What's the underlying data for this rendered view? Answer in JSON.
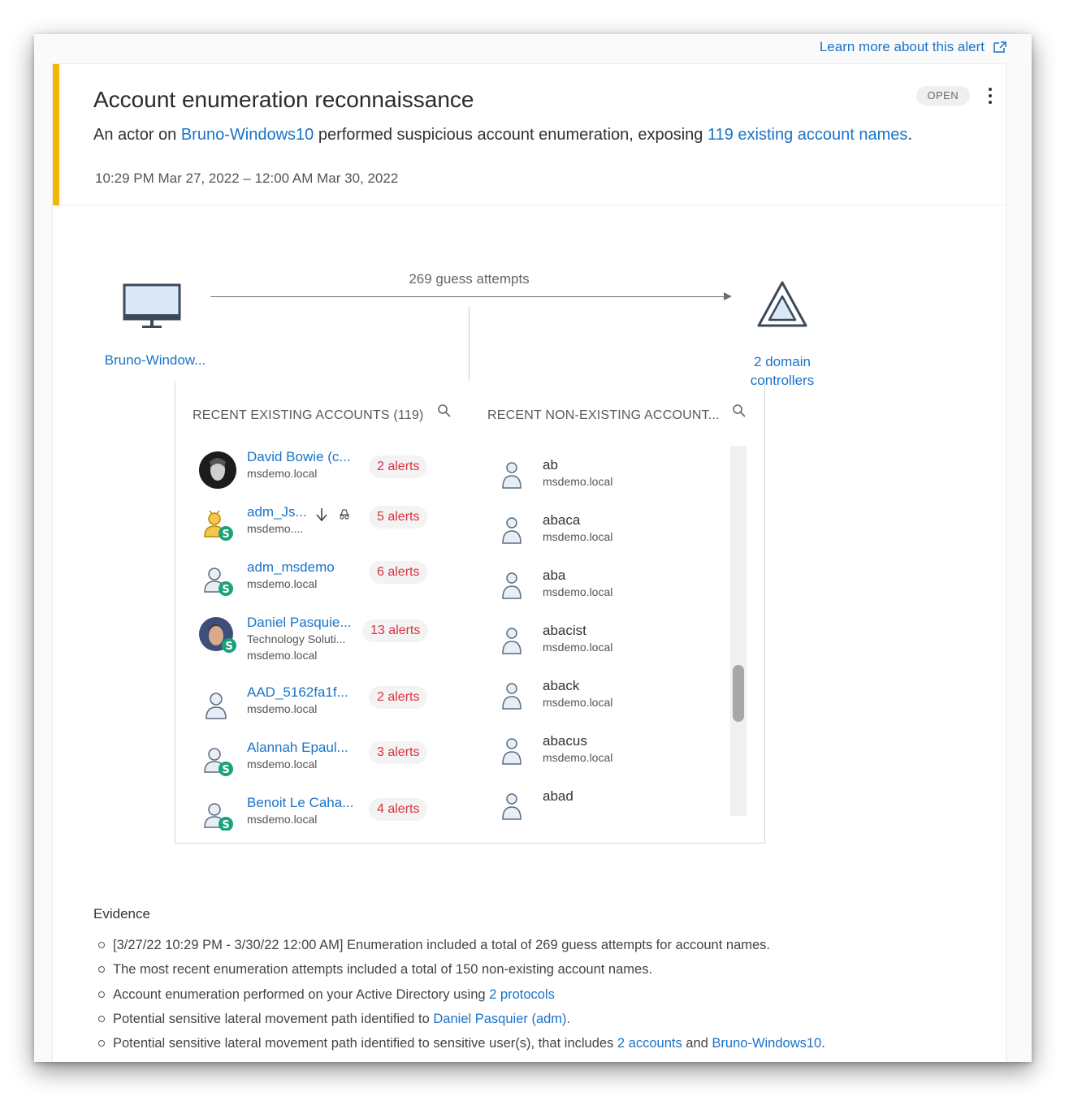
{
  "learn_more": "Learn more about this alert",
  "alert": {
    "title": "Account enumeration reconnaissance",
    "status": "OPEN",
    "desc_prefix": "An actor on ",
    "desc_host": "Bruno-Windows10",
    "desc_middle": " performed suspicious account enumeration, exposing ",
    "desc_accounts": "119 existing account names",
    "desc_suffix": ".",
    "time_range": "10:29 PM Mar 27, 2022 – 12:00 AM Mar 30, 2022",
    "severity_color": "#f2b705"
  },
  "graph": {
    "source_label": "Bruno-Window...",
    "attempts_label": "269 guess attempts",
    "target_label": "2 domain controllers",
    "icons": [
      "computer-icon",
      "domain-controller-icon"
    ]
  },
  "existing": {
    "header": "RECENT EXISTING ACCOUNTS (119)",
    "items": [
      {
        "name": "David Bowie (c...",
        "sub1": "msdemo.local",
        "sub2": "",
        "alerts": "2 alerts",
        "avatar": "photo-bowie"
      },
      {
        "name": "adm_Js...",
        "sub1": "msdemo....",
        "sub2": "",
        "alerts": "5 alerts",
        "avatar": "user-sensitive-icon"
      },
      {
        "name": "adm_msdemo",
        "sub1": "msdemo.local",
        "sub2": "",
        "alerts": "6 alerts",
        "avatar": "user-sensitive-icon"
      },
      {
        "name": "Daniel Pasquie...",
        "sub1": "Technology Soluti...",
        "sub2": "msdemo.local",
        "alerts": "13 alerts",
        "avatar": "photo-daniel"
      },
      {
        "name": "AAD_5162fa1f...",
        "sub1": "msdemo.local",
        "sub2": "",
        "alerts": "2 alerts",
        "avatar": "user-icon"
      },
      {
        "name": "Alannah Epaul...",
        "sub1": "msdemo.local",
        "sub2": "",
        "alerts": "3 alerts",
        "avatar": "user-sensitive-icon"
      },
      {
        "name": "Benoit Le Caha...",
        "sub1": "msdemo.local",
        "sub2": "",
        "alerts": "4 alerts",
        "avatar": "user-sensitive-icon"
      }
    ]
  },
  "nonexisting": {
    "header": "RECENT NON-EXISTING ACCOUNT...",
    "items": [
      {
        "name": "ab",
        "sub": "msdemo.local"
      },
      {
        "name": "abaca",
        "sub": "msdemo.local"
      },
      {
        "name": "aba",
        "sub": "msdemo.local"
      },
      {
        "name": "abacist",
        "sub": "msdemo.local"
      },
      {
        "name": "aback",
        "sub": "msdemo.local"
      },
      {
        "name": "abacus",
        "sub": "msdemo.local"
      },
      {
        "name": "abad",
        "sub": ""
      }
    ]
  },
  "evidence": {
    "title": "Evidence",
    "items": [
      {
        "pre": "[3/27/22 10:29 PM - 3/30/22 12:00 AM] Enumeration included a total of 269 guess attempts for account names.",
        "link1": "",
        "mid": "",
        "link2": "",
        "post": ""
      },
      {
        "pre": "The most recent enumeration attempts included a total of 150 non-existing account names.",
        "link1": "",
        "mid": "",
        "link2": "",
        "post": ""
      },
      {
        "pre": "Account enumeration performed on your Active Directory using ",
        "link1": "2 protocols",
        "mid": "",
        "link2": "",
        "post": ""
      },
      {
        "pre": "Potential sensitive lateral movement path identified to ",
        "link1": "Daniel Pasquier (adm)",
        "mid": "",
        "link2": "",
        "post": "."
      },
      {
        "pre": "Potential sensitive lateral movement path identified to sensitive user(s), that includes ",
        "link1": "2 accounts",
        "mid": " and ",
        "link2": "Bruno-Windows10",
        "post": "."
      }
    ]
  },
  "colors": {
    "link": "#1a73c8",
    "alert": "#d6333d",
    "sensitive_badge": "#1aa37a"
  }
}
